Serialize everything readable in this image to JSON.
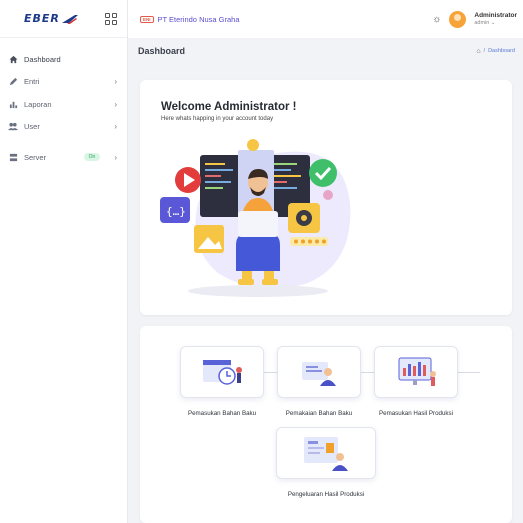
{
  "brand": {
    "logo_text": "EBER"
  },
  "topbar": {
    "company_badge": "ENI",
    "company_name": "PT Eterindo Nusa Graha",
    "user_name": "Administrator",
    "user_role": "admin"
  },
  "sidebar": {
    "items": [
      {
        "label": "Dashboard",
        "icon": "home-icon"
      },
      {
        "label": "Entri",
        "icon": "pen-icon"
      },
      {
        "label": "Laporan",
        "icon": "chart-icon"
      },
      {
        "label": "User",
        "icon": "users-icon"
      },
      {
        "label": "Server",
        "icon": "server-icon",
        "badge": "On"
      }
    ]
  },
  "page": {
    "title": "Dashboard",
    "breadcrumb": "Dashboard"
  },
  "welcome": {
    "title": "Welcome Administrator !",
    "subtitle": "Here whats happing in your account today"
  },
  "tiles": [
    {
      "label": "Pemasukan Bahan Baku"
    },
    {
      "label": "Pemakaian Bahan Baku"
    },
    {
      "label": "Pemasukan Hasil Produksi"
    },
    {
      "label": "Pengeluaran Hasil Produksi"
    }
  ],
  "colors": {
    "accent": "#5b4fcf",
    "brand": "#1d3a8a",
    "status_on": "#29a35d"
  }
}
